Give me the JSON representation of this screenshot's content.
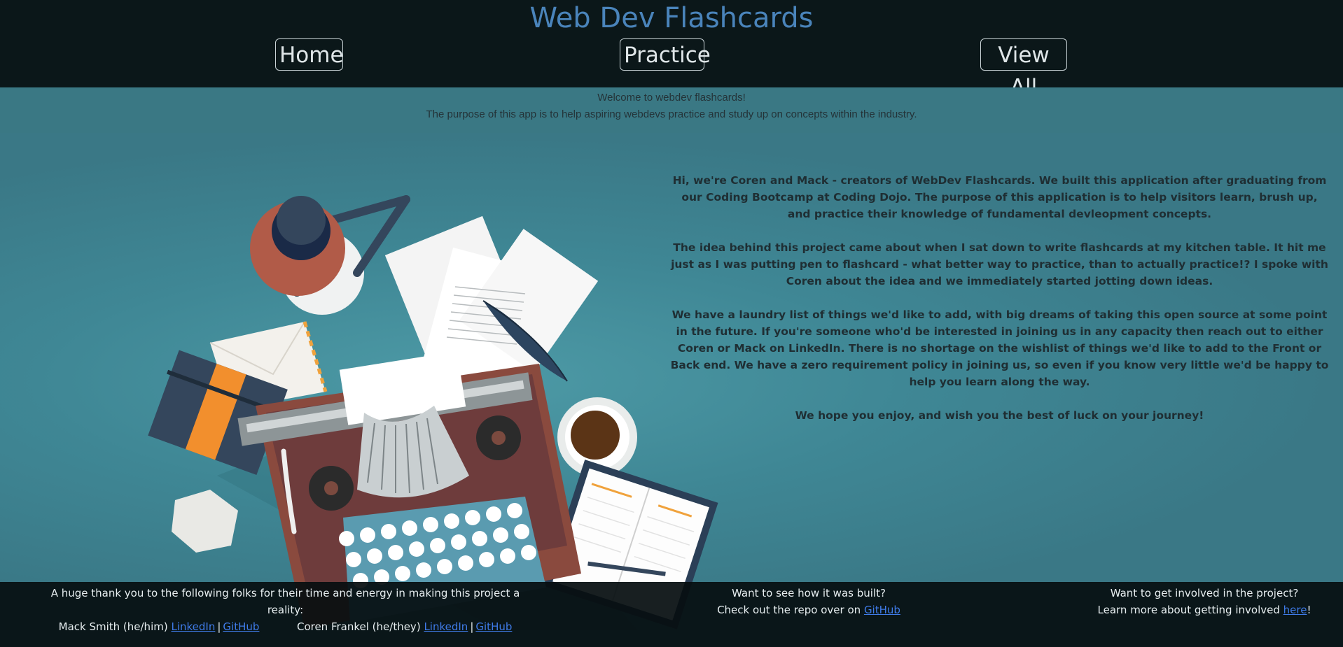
{
  "header": {
    "title": "Web Dev Flashcards",
    "nav": {
      "home": "Home",
      "practice": "Practice",
      "view_all": "View All"
    }
  },
  "welcome": {
    "line1": "Welcome to webdev flashcards!",
    "line2": "The purpose of this app is to help aspiring webdevs practice and study up on concepts within the industry."
  },
  "about": {
    "p1": "Hi, we're Coren and Mack - creators of WebDev Flashcards. We built this application after graduating from our Coding Bootcamp at Coding Dojo. The purpose of this application is to help visitors learn, brush up, and practice their knowledge of fundamental devleopment concepts.",
    "p2": "The idea behind this project came about when I sat down to write flashcards at my kitchen table. It hit me just as I was putting pen to flashcard - what better way to practice, than to actually practice!? I spoke with Coren about the idea and we immediately started jotting down ideas.",
    "p3": "We have a laundry list of things we'd like to add, with big dreams of taking this open source at some point in the future. If you're someone who'd be interested in joining us in any capacity then reach out to either Coren or Mack on LinkedIn. There is no shortage on the wishlist of things we'd like to add to the Front or Back end. We have a zero requirement policy in joining us, so even if you know very little we'd be happy to help you learn along the way.",
    "p4": "We hope you enjoy, and wish you the best of luck on your journey!"
  },
  "footer": {
    "thanks": "A huge thank you to the following folks for their time and energy in making this project a reality:",
    "person1": "Mack Smith (he/him)",
    "person2": "Coren Frankel (he/they)",
    "linkedin": "LinkedIn",
    "github": "GitHub",
    "separator": "|",
    "built_q": "Want to see how it was built?",
    "built_text": "Check out the repo over on",
    "built_link": "GitHub",
    "involved_q": "Want to get involved in the project?",
    "involved_text": "Learn more about getting involved",
    "involved_link": "here",
    "involved_end": "!"
  },
  "colors": {
    "header_bg": "#0b1719",
    "title": "#4a84bb",
    "body_bg": "#3b7c8a",
    "link": "#3f7be8",
    "footer_bg": "#060e10"
  }
}
